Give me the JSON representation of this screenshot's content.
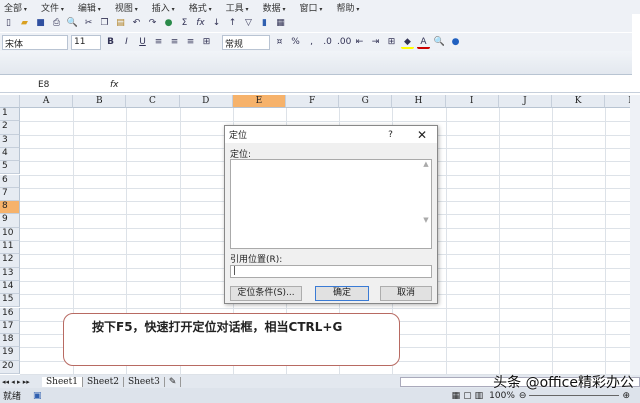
{
  "menu": [
    "全部",
    "文件",
    "编辑",
    "视图",
    "插入",
    "格式",
    "工具",
    "数据",
    "窗口",
    "帮助"
  ],
  "toolbar": {
    "font": "宋体",
    "size": "11",
    "bold": "B",
    "italic": "I",
    "underline": "U",
    "number_format": "常规",
    "percent": "%",
    "comma": ",",
    "sum": "Σ",
    "fx": "fx"
  },
  "formula": {
    "name_box": "E8",
    "fx": "fx",
    "value": ""
  },
  "columns": [
    "A",
    "B",
    "C",
    "D",
    "E",
    "F",
    "G",
    "H",
    "I",
    "J",
    "K",
    "L"
  ],
  "rows": [
    "1",
    "2",
    "3",
    "4",
    "5",
    "6",
    "7",
    "8",
    "9",
    "10",
    "11",
    "12",
    "13",
    "14",
    "15",
    "16",
    "17",
    "18",
    "19",
    "20"
  ],
  "active": {
    "column": "E",
    "row": "8"
  },
  "dialog": {
    "title": "定位",
    "help": "?",
    "close": "✕",
    "goto_label": "定位:",
    "ref_label": "引用位置(R):",
    "ref_value": "|",
    "special_button": "定位条件(S)...",
    "ok_button": "确定",
    "cancel_button": "取消"
  },
  "callout": "按下F5，快速打开定位对话框，相当CTRL+G",
  "sheets": [
    "Sheet1",
    "Sheet2",
    "Sheet3"
  ],
  "status": {
    "ready": "就绪",
    "zoom": "100%"
  },
  "watermark": "头条 @office精彩办公"
}
